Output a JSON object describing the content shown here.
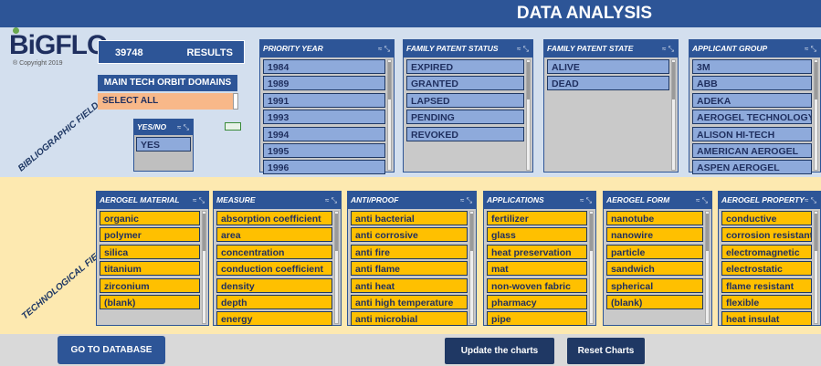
{
  "header": {
    "title": "DATA ANALYSIS"
  },
  "brand": {
    "logo": "BiGFLO",
    "copyright": "® Copyright 2019"
  },
  "sections": {
    "bibliographic": "BIBLIOGRAPHIC FIELD",
    "technological": "TECHNOLOGICAL FIELD"
  },
  "results": {
    "count": "39748",
    "label": "RESULTS"
  },
  "main_tech": {
    "label": "MAIN TECH  ORBIT DOMAINS",
    "select_value": "SELECT ALL"
  },
  "yes_no": {
    "title": "YES/NO",
    "items": [
      "YES"
    ]
  },
  "bibliographic_slicers": [
    {
      "title": "PRIORITY YEAR",
      "items": [
        "1984",
        "1989",
        "1991",
        "1993",
        "1994",
        "1995",
        "1996"
      ]
    },
    {
      "title": "FAMILY PATENT STATUS",
      "items": [
        "EXPIRED",
        "GRANTED",
        "LAPSED",
        "PENDING",
        "REVOKED"
      ]
    },
    {
      "title": "FAMILY PATENT STATE",
      "items": [
        "ALIVE",
        "DEAD"
      ]
    },
    {
      "title": "APPLICANT GROUP",
      "items": [
        "3M",
        "ABB",
        "ADEKA",
        "AEROGEL TECHNOLOGY",
        "ALISON HI-TECH",
        "AMERICAN AEROGEL",
        "ASPEN AEROGEL"
      ]
    }
  ],
  "tech_slicers": [
    {
      "title": "AEROGEL MATERIAL",
      "items": [
        "organic",
        "polymer",
        "silica",
        "titanium",
        "zirconium",
        "(blank)"
      ]
    },
    {
      "title": "MEASURE",
      "items": [
        "absorption coefficient",
        "area",
        "concentration",
        "conduction coefficient",
        "density",
        "depth",
        "energy"
      ]
    },
    {
      "title": "ANTI/PROOF",
      "items": [
        "anti bacterial",
        "anti corrosive",
        "anti fire",
        "anti flame",
        "anti heat",
        "anti high temperature",
        "anti microbial"
      ]
    },
    {
      "title": "APPLICATIONS",
      "items": [
        "fertilizer",
        "glass",
        "heat preservation",
        "mat",
        "non-woven fabric",
        "pharmacy",
        "pipe"
      ]
    },
    {
      "title": "AEROGEL FORM",
      "items": [
        "nanotube",
        "nanowire",
        "particle",
        "sandwich",
        "spherical",
        "(blank)"
      ]
    },
    {
      "title": "AEROGEL PROPERTY",
      "items": [
        "conductive",
        "corrosion resistant",
        "electromagnetic",
        "electrostatic",
        "flame resistant",
        "flexible",
        "heat insulat"
      ]
    }
  ],
  "footer": {
    "go_to_database": "GO TO DATABASE",
    "update_charts": "Update the charts",
    "reset_charts": "Reset Charts"
  },
  "icons": {
    "filter": "filter-clear-icon",
    "toggle": "toggle-icon"
  },
  "colors": {
    "header": "#2d5597",
    "biblio_bg": "#d3dfee",
    "tech_bg": "#fde9b0",
    "blue_item": "#8eaadb",
    "orange_item": "#ffc000",
    "button_dark": "#1f3864"
  }
}
